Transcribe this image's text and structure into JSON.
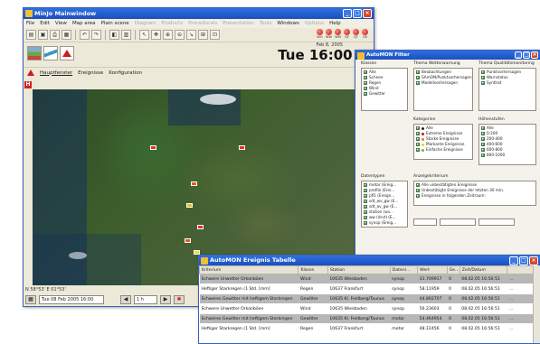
{
  "main_window": {
    "title": "MinJo Mainwindow",
    "menu": [
      {
        "label": "File",
        "enabled": true
      },
      {
        "label": "Edit",
        "enabled": true
      },
      {
        "label": "View",
        "enabled": true
      },
      {
        "label": "Map area",
        "enabled": true
      },
      {
        "label": "Plain scene",
        "enabled": true
      },
      {
        "label": "Diagram",
        "enabled": false
      },
      {
        "label": "Products",
        "enabled": false
      },
      {
        "label": "Procedurals",
        "enabled": false
      },
      {
        "label": "Presentation",
        "enabled": false
      },
      {
        "label": "Tools",
        "enabled": false
      },
      {
        "label": "Windows",
        "enabled": true
      },
      {
        "label": "Options",
        "enabled": false
      },
      {
        "label": "Help",
        "enabled": true
      }
    ],
    "status_leds": [
      "WO",
      "WW",
      "WM",
      "QF",
      "QT",
      "QS"
    ],
    "date": "Feb 8, 2005",
    "time": "Tue 16:00 U",
    "tabs": [
      "Hauptfenster",
      "Ereignisse",
      "Konfiguration"
    ],
    "coordinates": "N 58°53' E 01°53'",
    "time_field": "Tue 08 Feb 2005 16:00",
    "step_field": "1 h"
  },
  "filter_window": {
    "title": "AutoMON Filter",
    "sections": {
      "klassen": {
        "label": "Klassen",
        "items": [
          "Alle",
          "Schnee",
          "Regen",
          "Wind",
          "Gewitter"
        ]
      },
      "wetter": {
        "label": "Thema Wetterwarnung",
        "items": [
          "Beobachtungen",
          "SAmON/Punktvorhersagen",
          "Modellvorhersagen"
        ]
      },
      "qualitaet": {
        "label": "Thema Qualitätsmonitoring",
        "items": [
          "Punktvorhersagen",
          "Warnstatus",
          "Synthat"
        ]
      },
      "kategorien": {
        "label": "Kategorien",
        "items": [
          {
            "label": "Alle",
            "color": "#222222"
          },
          {
            "label": "Extreme Ereignisse",
            "color": "#d01010"
          },
          {
            "label": "Starke Ereignisse",
            "color": "#e87a10"
          },
          {
            "label": "Markante Ereignisse",
            "color": "#e8d010"
          },
          {
            "label": "Einfache Ereignisse",
            "color": "#70b030"
          }
        ]
      },
      "hoehenstufen": {
        "label": "Höhenstufen",
        "items": [
          "Alle",
          "0-200",
          "200-400",
          "400-600",
          "600-800",
          "800-1000"
        ]
      },
      "datentypen": {
        "label": "Datentypen",
        "items": [
          "metar (Ereig...",
          "profile (Erei...",
          "pfl1 (Ereign...",
          "sdt_wv_gw (E...",
          "sdt_av_gw (E...",
          "station (wv...",
          "ww (drvt) (E...",
          "synop (Ereig..."
        ]
      },
      "anzeige": {
        "label": "Anzeigekriterium",
        "items": [
          "Alle unbestätigten Ereignisse",
          "Unbestätigte Ereignisse der letzten 30 min.",
          "Ereignisse in folgenden Zeitraum:"
        ]
      }
    }
  },
  "table_window": {
    "title": "AutoMON Ereignis Tabelle",
    "columns": [
      "Kriterium",
      "Klasse",
      "Station",
      "Datenl...",
      "Wert",
      "Ge...",
      "Zeit/Datum",
      ""
    ],
    "rows": [
      [
        "Schwere Unwetter Orkanböen",
        "Wind",
        "10635 Wiesbaden",
        "synop",
        "31.709917",
        "0",
        "08.02.05 16:56:51",
        "..."
      ],
      [
        "Heftiger Starkregen (1 Std. [mm]",
        "Regen",
        "10637 Frankfurt",
        "synop",
        "58.11959",
        "0",
        "08.02.05 16:56:51",
        "..."
      ],
      [
        "Schweres Gewitter mit heftigem Starkregen",
        "Gewitter",
        "10635 Kl. Feldberg/Taunus",
        "synop",
        "44.892707",
        "0",
        "08.02.05 16:56:51",
        "..."
      ],
      [
        "Schwere Unwetter Orkanböen",
        "Wind",
        "10635 Wiesbaden",
        "synop",
        "56.23603",
        "0",
        "08.02.05 16:56:51",
        "..."
      ],
      [
        "Schweres Gewitter mit heftigem Starkregen",
        "Gewitter",
        "10635 Kl. Feldberg/Taunus",
        "metar",
        "54.464954",
        "0",
        "08.02.05 16:56:51",
        "..."
      ],
      [
        "Heftiger Starkregen (1 Std. [mm]",
        "Regen",
        "10637 Frankfurt",
        "metar",
        "48.12456",
        "0",
        "08.02.05 16:56:51",
        "..."
      ]
    ]
  },
  "colors": {
    "titlebar": "#1b4fbf",
    "alert_red": "#d01c1c",
    "row_gray": "#b7b7b7"
  }
}
